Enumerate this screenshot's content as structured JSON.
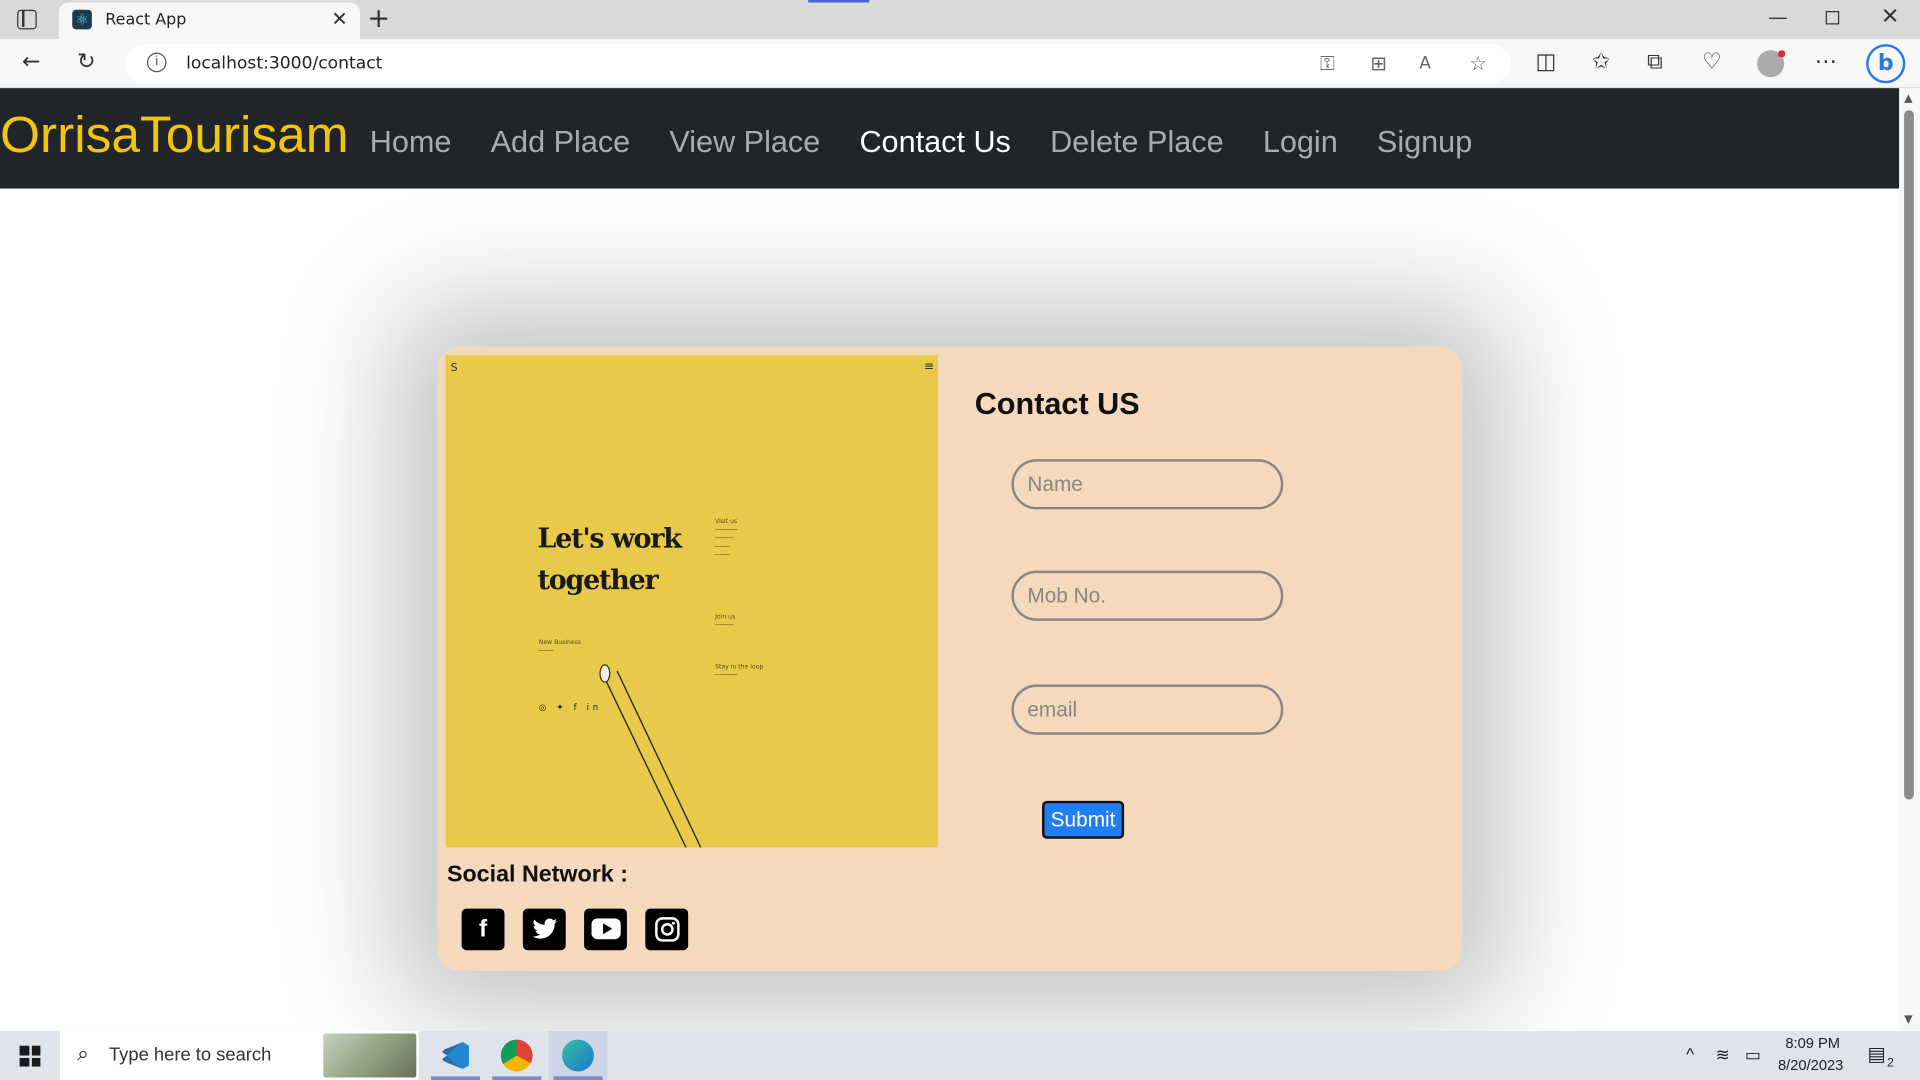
{
  "browser": {
    "tab_title": "React App",
    "url": "localhost:3000/contact",
    "new_tab": "+",
    "close_glyph": "✕"
  },
  "navbar": {
    "brand": "OrrisaTourisam",
    "links": [
      "Home",
      "Add Place",
      "View Place",
      "Contact Us",
      "Delete Place",
      "Login",
      "Signup"
    ],
    "active": "Contact Us"
  },
  "poster": {
    "headline": "Let's work together",
    "blocks": {
      "visit": "Visit us",
      "join": "Join us",
      "loop": "Stay in the loop",
      "new_business": "New Business"
    }
  },
  "social": {
    "title": "Social Network :",
    "icons": [
      "facebook-icon",
      "twitter-icon",
      "youtube-icon",
      "instagram-icon"
    ]
  },
  "form": {
    "title": "Contact US",
    "name_placeholder": "Name",
    "mobile_placeholder": "Mob No.",
    "email_placeholder": "email",
    "submit_label": "Submit"
  },
  "taskbar": {
    "search_placeholder": "Type here to search",
    "time": "8:09 PM",
    "date": "8/20/2023",
    "notifications": "2"
  },
  "colors": {
    "navbar_bg": "#212529",
    "brand": "#f1c40f",
    "card_bg": "#f4d9bc",
    "poster_bg": "#e9c94a",
    "submit_bg": "#1f7ef2"
  }
}
